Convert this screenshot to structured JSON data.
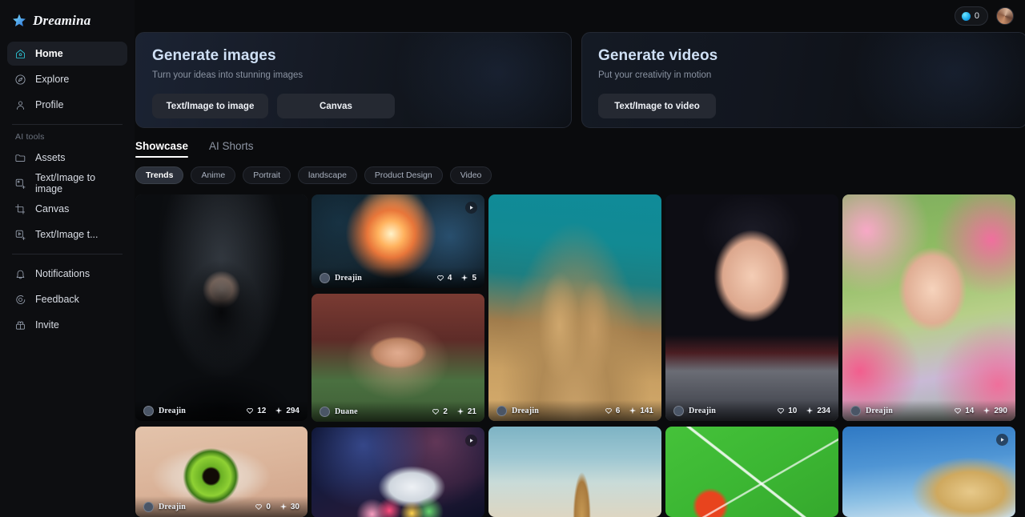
{
  "brand": {
    "name": "Dreamina",
    "logo_icon": "sparkle-logo-icon"
  },
  "sidebar": {
    "primary": [
      {
        "label": "Home",
        "icon": "home-icon",
        "key": "home",
        "active": true
      },
      {
        "label": "Explore",
        "icon": "compass-icon",
        "key": "explore",
        "active": false
      },
      {
        "label": "Profile",
        "icon": "person-icon",
        "key": "profile",
        "active": false
      }
    ],
    "section_label": "AI tools",
    "tools": [
      {
        "label": "Assets",
        "icon": "folder-icon",
        "key": "assets"
      },
      {
        "label": "Text/Image to image",
        "icon": "image-plus-icon",
        "key": "text-image-to-image"
      },
      {
        "label": "Canvas",
        "icon": "crop-frame-icon",
        "key": "canvas"
      },
      {
        "label": "Text/Image t...",
        "icon": "video-plus-icon",
        "key": "text-image-to-video"
      }
    ],
    "footer": [
      {
        "label": "Notifications",
        "icon": "bell-icon",
        "key": "notifications"
      },
      {
        "label": "Feedback",
        "icon": "chat-icon",
        "key": "feedback"
      },
      {
        "label": "Invite",
        "icon": "gift-icon",
        "key": "invite"
      }
    ]
  },
  "topbar": {
    "credits_value": "0",
    "credits_icon": "credit-coin-icon",
    "avatar_label": "user-avatar"
  },
  "banners": [
    {
      "title": "Generate images",
      "subtitle": "Turn your ideas into stunning images",
      "buttons": [
        "Text/Image to image",
        "Canvas"
      ]
    },
    {
      "title": "Generate videos",
      "subtitle": "Put your creativity in motion",
      "buttons": [
        "Text/Image to video"
      ]
    }
  ],
  "tabs": [
    {
      "label": "Showcase",
      "active": true
    },
    {
      "label": "AI Shorts",
      "active": false
    }
  ],
  "chips": [
    {
      "label": "Trends",
      "active": true
    },
    {
      "label": "Anime",
      "active": false
    },
    {
      "label": "Portrait",
      "active": false
    },
    {
      "label": "landscape",
      "active": false
    },
    {
      "label": "Product Design",
      "active": false
    },
    {
      "label": "Video",
      "active": false
    }
  ],
  "gallery": {
    "columns": [
      {
        "cards": [
          {
            "art": "art-goth",
            "name": "gothic-portrait",
            "user": "Dreajin",
            "likes": "12",
            "stars": "294",
            "video": false,
            "show_overlay": true
          },
          {
            "art": "art-eye",
            "name": "green-eye-macro",
            "user": "Dreajin",
            "likes": "0",
            "stars": "30",
            "video": false,
            "show_overlay": true
          }
        ]
      },
      {
        "cards": [
          {
            "art": "art-rose",
            "name": "burning-rose",
            "user": "Dreajin",
            "likes": "4",
            "stars": "5",
            "video": true,
            "show_overlay": true
          },
          {
            "art": "art-taj",
            "name": "taj-mahal-render",
            "user": "Duane",
            "likes": "2",
            "stars": "21",
            "video": false,
            "show_overlay": true
          },
          {
            "art": "art-space",
            "name": "astronaut-flowers",
            "user": "",
            "likes": "",
            "stars": "",
            "video": true,
            "show_overlay": false
          }
        ]
      },
      {
        "cards": [
          {
            "art": "art-sand",
            "name": "sand-castle-dragon",
            "user": "Dreajin",
            "likes": "6",
            "stars": "141",
            "video": false,
            "show_overlay": true
          },
          {
            "art": "art-tower",
            "name": "desert-tower",
            "user": "",
            "likes": "",
            "stars": "",
            "video": false,
            "show_overlay": false
          }
        ]
      },
      {
        "cards": [
          {
            "art": "art-anime",
            "name": "anime-warrior-girl",
            "user": "Dreajin",
            "likes": "10",
            "stars": "234",
            "video": false,
            "show_overlay": true
          },
          {
            "art": "art-green",
            "name": "green-illustration",
            "user": "",
            "likes": "",
            "stars": "",
            "video": false,
            "show_overlay": false
          }
        ]
      },
      {
        "cards": [
          {
            "art": "art-tulip",
            "name": "tulip-field-portrait",
            "user": "Dreajin",
            "likes": "14",
            "stars": "290",
            "video": false,
            "show_overlay": true
          },
          {
            "art": "art-hair",
            "name": "windblown-hair-sky",
            "user": "",
            "likes": "",
            "stars": "",
            "video": true,
            "show_overlay": false
          }
        ]
      }
    ]
  }
}
